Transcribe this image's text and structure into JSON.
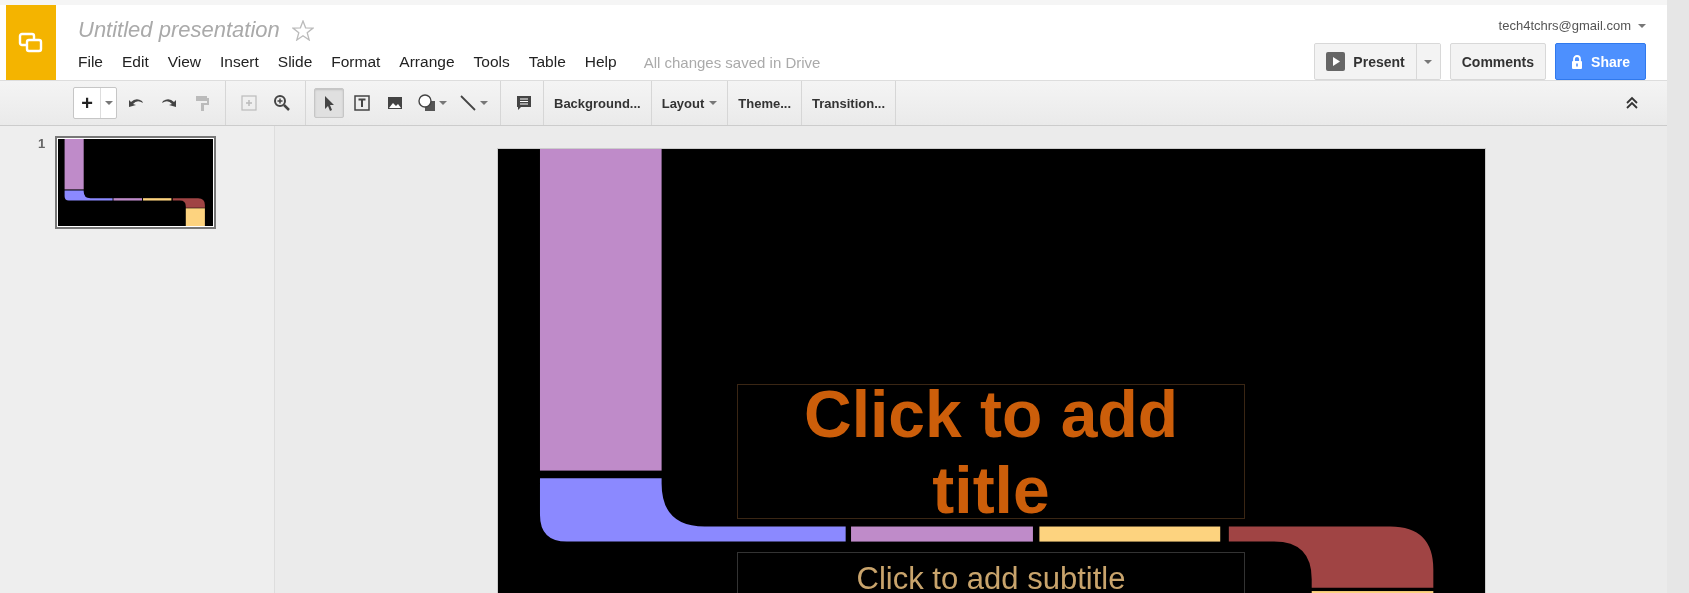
{
  "app": {
    "document_title": "Untitled presentation",
    "starred": false,
    "menu": [
      "File",
      "Edit",
      "View",
      "Insert",
      "Slide",
      "Format",
      "Arrange",
      "Tools",
      "Table",
      "Help"
    ],
    "save_status": "All changes saved in Drive",
    "account": "tech4tchrs@gmail.com"
  },
  "actions": {
    "present": "Present",
    "comments": "Comments",
    "share": "Share"
  },
  "toolbar": {
    "new_slide": "+",
    "edit_tools": [
      {
        "kind": "undo",
        "disabled": false
      },
      {
        "kind": "redo",
        "disabled": false
      },
      {
        "kind": "paint-format",
        "disabled": true
      }
    ],
    "view_tools": [
      {
        "kind": "fit",
        "disabled": true
      },
      {
        "kind": "zoom",
        "disabled": false
      }
    ],
    "draw_tools": [
      {
        "kind": "select",
        "selected": true,
        "dropdown": false
      },
      {
        "kind": "textbox",
        "selected": false,
        "dropdown": false
      },
      {
        "kind": "image",
        "selected": false,
        "dropdown": false
      },
      {
        "kind": "shape",
        "selected": false,
        "dropdown": true
      },
      {
        "kind": "line",
        "selected": false,
        "dropdown": true
      }
    ],
    "comment_tool": {
      "kind": "comment"
    },
    "buttons": [
      {
        "label": "Background...",
        "dropdown": false
      },
      {
        "label": "Layout",
        "dropdown": true
      },
      {
        "label": "Theme...",
        "dropdown": false
      },
      {
        "label": "Transition...",
        "dropdown": false
      }
    ]
  },
  "slides": [
    {
      "number": "1",
      "selected": true
    }
  ],
  "slide": {
    "title_placeholder": "Click to add title",
    "subtitle_placeholder": "Click to add subtitle"
  }
}
